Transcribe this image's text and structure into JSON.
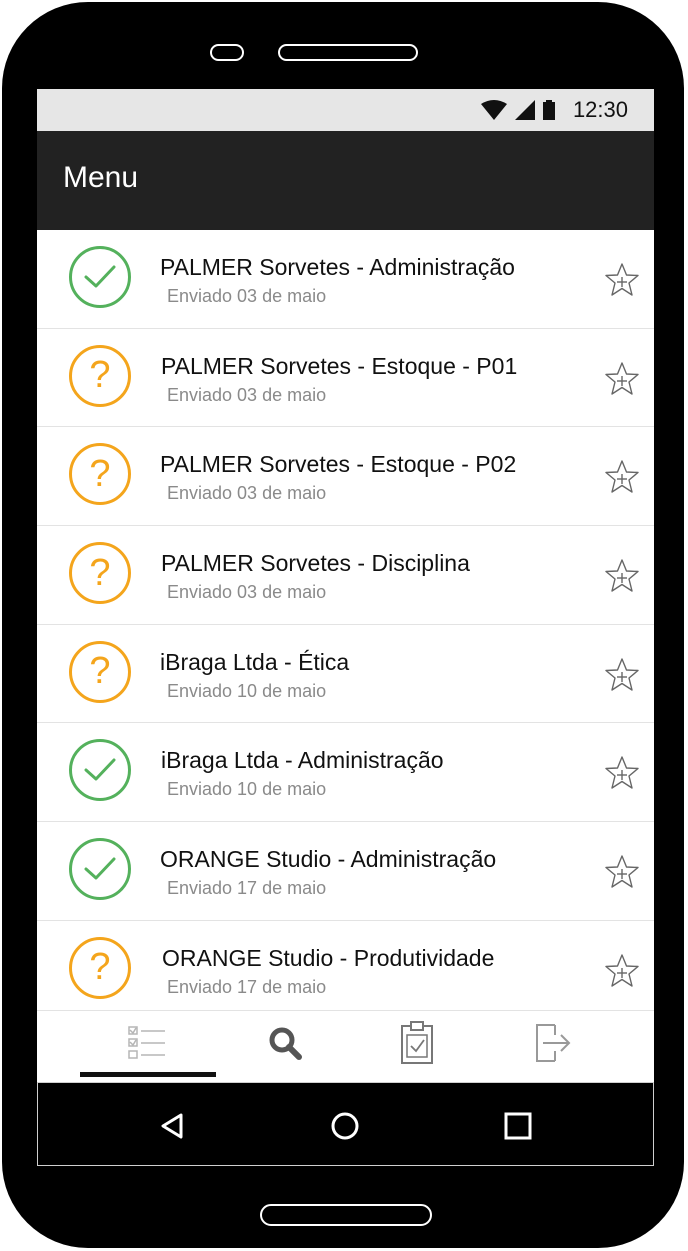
{
  "status_bar": {
    "time": "12:30"
  },
  "app_bar": {
    "title": "Menu"
  },
  "colors": {
    "ok": "#54b15c",
    "pending": "#f4a51c",
    "appbar": "#222222"
  },
  "items": [
    {
      "title": "PALMER Sorvetes - Administração",
      "subtitle": "Enviado 03 de maio",
      "status": "ok",
      "status_glyph": ""
    },
    {
      "title": "PALMER Sorvetes - Estoque - P01",
      "subtitle": "Enviado 03 de maio",
      "status": "pending",
      "status_glyph": "?"
    },
    {
      "title": "PALMER Sorvetes - Estoque - P02",
      "subtitle": "Enviado 03 de maio",
      "status": "pending",
      "status_glyph": "?"
    },
    {
      "title": "PALMER Sorvetes - Disciplina",
      "subtitle": "Enviado 03 de maio",
      "status": "pending",
      "status_glyph": "?"
    },
    {
      "title": "iBraga Ltda - Ética",
      "subtitle": "Enviado 10 de maio",
      "status": "pending",
      "status_glyph": "?"
    },
    {
      "title": "iBraga Ltda - Administração",
      "subtitle": "Enviado 10 de maio",
      "status": "ok",
      "status_glyph": ""
    },
    {
      "title": "ORANGE Studio - Administração",
      "subtitle": "Enviado 17 de maio",
      "status": "ok",
      "status_glyph": ""
    },
    {
      "title": "ORANGE Studio - Produtividade",
      "subtitle": "Enviado 17 de maio",
      "status": "pending",
      "status_glyph": "?"
    }
  ],
  "tabs": [
    {
      "icon": "checklist-icon",
      "active": true
    },
    {
      "icon": "search-icon",
      "active": false
    },
    {
      "icon": "clipboard-check-icon",
      "active": false
    },
    {
      "icon": "logout-icon",
      "active": false
    }
  ],
  "nav_buttons": [
    "back-icon",
    "home-icon",
    "recents-icon"
  ]
}
